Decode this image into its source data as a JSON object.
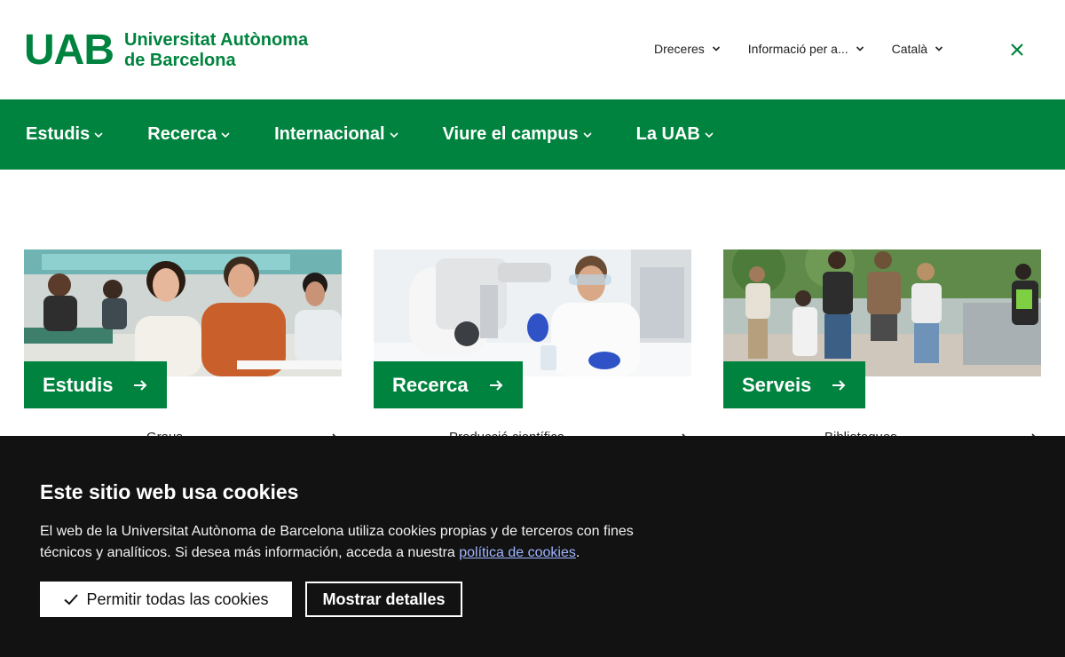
{
  "header": {
    "logo_mark": "UAB",
    "logo_line1": "Universitat Autònoma",
    "logo_line2": "de Barcelona",
    "links": [
      {
        "label": "Dreceres",
        "icon": "chevron-down-icon"
      },
      {
        "label": "Informació per a...",
        "icon": "chevron-down-icon"
      },
      {
        "label": "Català",
        "icon": "chevron-down-icon"
      }
    ],
    "close_icon": "close-icon"
  },
  "nav": {
    "items": [
      {
        "label": "Estudis"
      },
      {
        "label": "Recerca"
      },
      {
        "label": "Internacional"
      },
      {
        "label": "Viure el campus"
      },
      {
        "label": "La UAB"
      }
    ]
  },
  "cards": [
    {
      "label": "Estudis",
      "sub": "Graus",
      "image": "students-classroom-photo"
    },
    {
      "label": "Recerca",
      "sub": "Producció científica",
      "image": "lab-microscope-photo"
    },
    {
      "label": "Serveis",
      "sub": "Biblioteques",
      "image": "students-walking-campus-photo"
    }
  ],
  "cookie": {
    "title": "Este sitio web usa cookies",
    "text": "El web de la Universitat Autònoma de Barcelona utiliza cookies propias y de terceros con fines técnicos y analíticos. Si desea más información, acceda a nuestra ",
    "link": "política de cookies",
    "text_end": ".",
    "allow_label": "Permitir todas las cookies",
    "details_label": "Mostrar detalles"
  },
  "colors": {
    "brand_green": "#00833e",
    "banner_bg": "#121212",
    "link_blue": "#9fb4ff"
  }
}
